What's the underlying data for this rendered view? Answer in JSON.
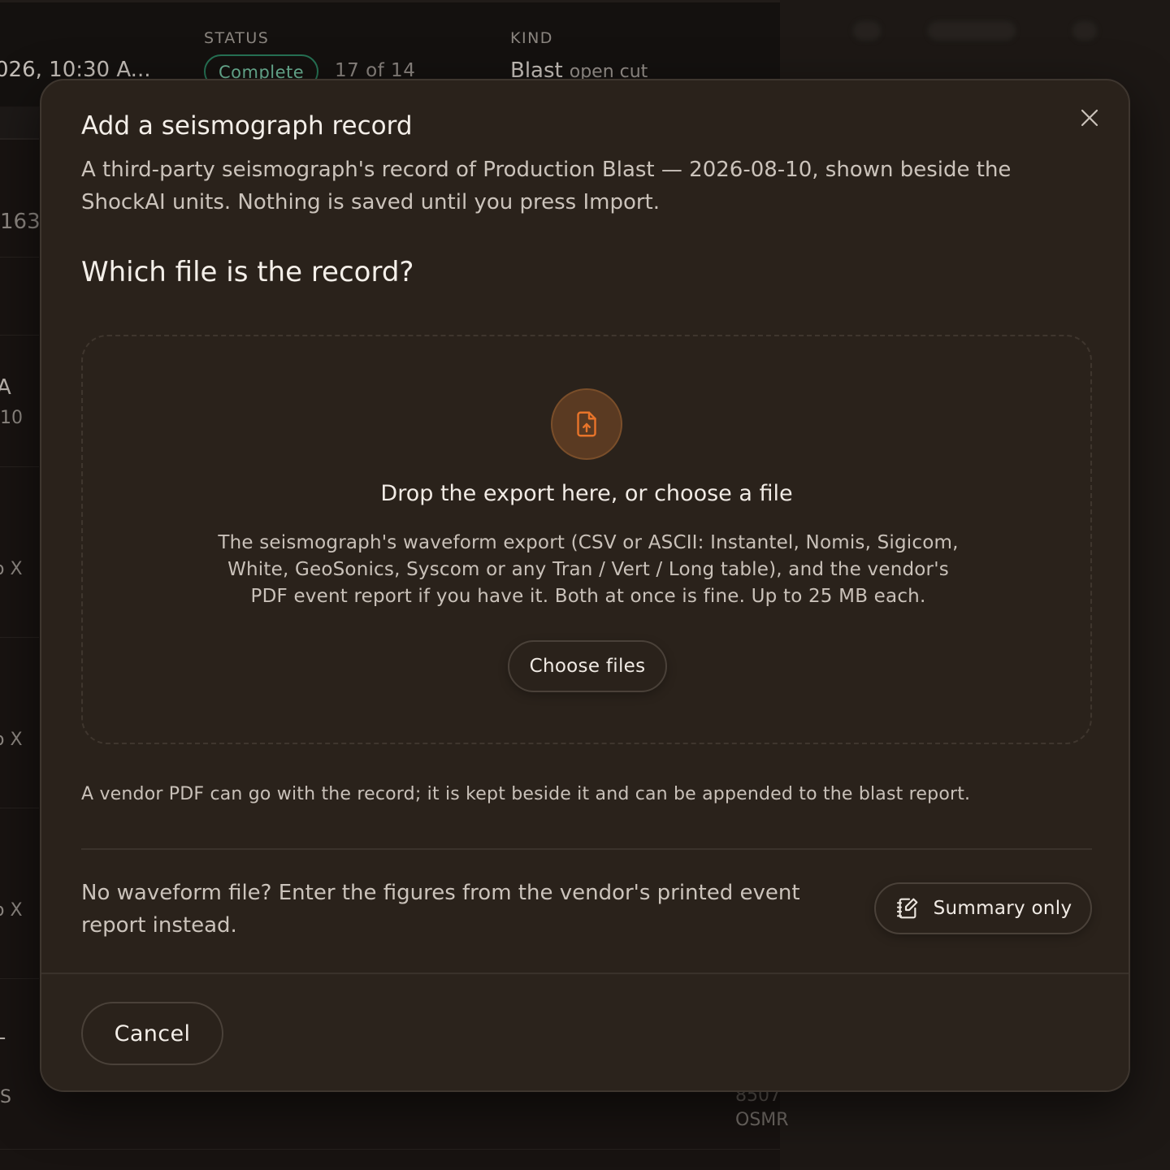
{
  "background": {
    "time_value": "026, 10:30 A...",
    "status_label": "STATUS",
    "status_badge": "Complete",
    "status_count": "17 of 14",
    "kind_label": "KIND",
    "kind_value": "Blast",
    "kind_sub": "open cut",
    "left_fragments": [
      "163",
      "A",
      "10",
      "o X",
      "o X",
      "o X",
      "-",
      "S"
    ],
    "bottom_fragments": [
      "8507",
      "OSMR"
    ]
  },
  "modal": {
    "title": "Add a seismograph record",
    "description": "A third-party seismograph's record of Production Blast — 2026-08-10, shown beside the ShockAI units. Nothing is saved until you press Import.",
    "section_title": "Which file is the record?",
    "dropzone": {
      "icon": "file-upload-icon",
      "heading": "Drop the export here, or choose a file",
      "description": "The seismograph's waveform export (CSV or ASCII: Instantel, Nomis, Sigicom, White, GeoSonics, Syscom or any Tran / Vert / Long table), and the vendor's PDF event report if you have it. Both at once is fine. Up to 25 MB each.",
      "button_label": "Choose files"
    },
    "pdf_note": "A vendor PDF can go with the record; it is kept beside it and can be appended to the blast report.",
    "no_waveform_text": "No waveform file? Enter the figures from the vendor's printed event report instead.",
    "summary_button_label": "Summary only",
    "cancel_label": "Cancel"
  },
  "colors": {
    "accent": "#e8742a",
    "status_green": "#2c8a66",
    "modal_bg": "#2a221b"
  }
}
